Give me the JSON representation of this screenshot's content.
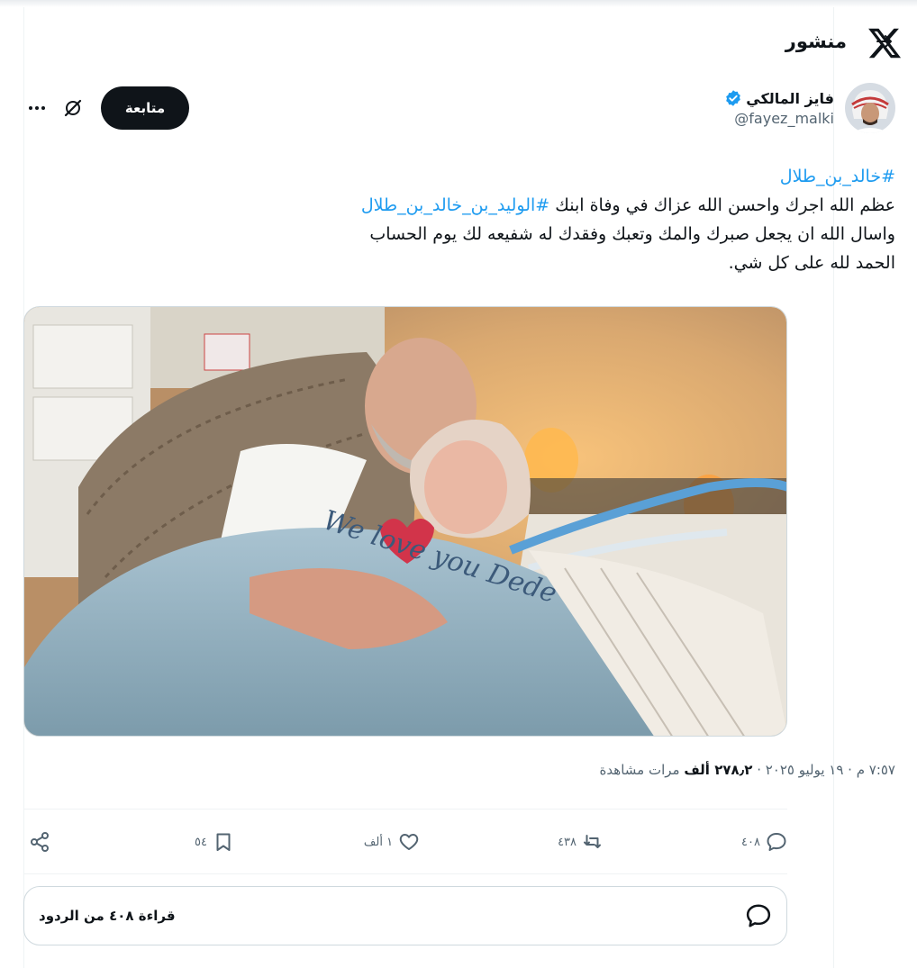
{
  "header": {
    "title": "منشور"
  },
  "author": {
    "name": "فايز المالكي",
    "handle": "@fayez_malki",
    "follow_label": "متابعة"
  },
  "tweet": {
    "hashtag_top": "#خالد_بن_طلال",
    "line1_text": "عظم الله اجرك واحسن الله عزاك في وفاة ابنك ",
    "line1_hashtag": "#الوليد_بن_خالد_بن_طلال",
    "line2": "واسال الله ان يجعل صبرك والمك  وتعبك  وفقدك له شفيعه لك يوم الحساب",
    "line3": "الحمد لله على كل شي."
  },
  "media": {
    "blanket_text": "We love you Dede"
  },
  "meta": {
    "time_date": "٧:٥٧ م · ١٩ يوليو ٢٠٢٥ · ",
    "views_count": "٢٧٨٫٢ ألف",
    "views_label": " مرات مشاهدة"
  },
  "actions": {
    "replies": "٤٠٨",
    "reposts": "٤٣٨",
    "likes": "١ ألف",
    "bookmarks": "٥٤"
  },
  "replies_box": {
    "label": "قراءة ٤٠٨ من الردود"
  },
  "colors": {
    "accent": "#1d9bf0",
    "text": "#0f1419",
    "muted": "#536471",
    "border": "#cfd9de"
  }
}
